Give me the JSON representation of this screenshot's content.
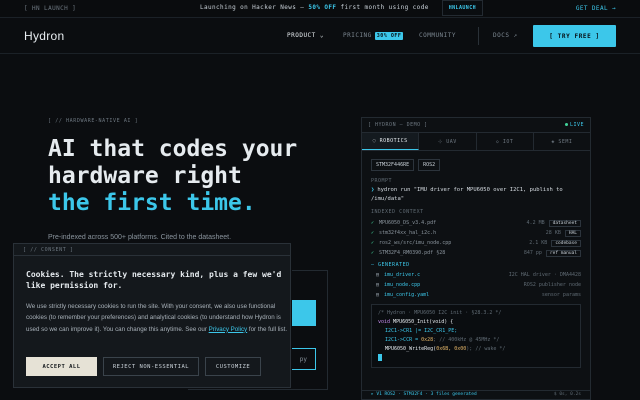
{
  "announce": {
    "tag": "[ HN LAUNCH ]",
    "msg_prefix": "Launching on Hacker News — ",
    "msg_highlight": "50% OFF",
    "msg_mid": " first month using code ",
    "msg_code": "HNLAUNCH",
    "deal": "GET DEAL →"
  },
  "nav": {
    "logo": "Hydron",
    "items": [
      {
        "label": "PRODUCT ⌄"
      },
      {
        "label": "PRICING",
        "badge": "30% OFF"
      },
      {
        "label": "COMMUNITY"
      },
      {
        "label": "DOCS ↗"
      }
    ],
    "cta": "[ TRY FREE ]"
  },
  "hero": {
    "eyebrow": "[ // HARDWARE-NATIVE AI ]",
    "line1": "AI that codes your",
    "line2": "hardware right",
    "line3": "the first time.",
    "sub": "Pre-indexed across 500+ platforms. Cited to the datasheet.",
    "ghost_tail": "py"
  },
  "demo": {
    "header": "[ HYDRON — DEMO ]",
    "live": "LIVE",
    "tabs": [
      "◌ ROBOTICS",
      "⊹ UAV",
      "◇ IOT",
      "◈ SEMI"
    ],
    "chips": [
      "STM32F446RE",
      "ROS2"
    ],
    "prompt_label": "PROMPT",
    "prompt_text": "hydron run \"IMU driver for MPU6050 over I2C1, publish to /imu/data\"",
    "context_label": "INDEXED CONTEXT",
    "context": [
      {
        "name": "MPU6050_DS_v3.4.pdf",
        "size": "4.2 MB",
        "tag": "datasheet"
      },
      {
        "name": "stm32f4xx_hal_i2c.h",
        "size": "28 KB",
        "tag": "HAL"
      },
      {
        "name": "ros2_ws/src/imu_node.cpp",
        "size": "2.1 KB",
        "tag": "codebase"
      },
      {
        "name": "STM32F4_RM0390.pdf §28",
        "size": "847 pp",
        "tag": "ref manual"
      }
    ],
    "generated_label": "— GENERATED",
    "generated": [
      {
        "name": "imu_driver.c",
        "desc": "I2C HAL driver · DMA4428"
      },
      {
        "name": "imu_node.cpp",
        "desc": "ROS2 publisher node"
      },
      {
        "name": "imu_config.yaml",
        "desc": "sensor params"
      }
    ],
    "code": {
      "comment": "/* Hydron · MPU6050 I2C init · §28.3.2 */",
      "sig_kw": "void",
      "sig_fn": " MPU6050_Init(void) {",
      "l1a": "I2C1->CR1  |= I2C_CR1_PE;",
      "l2a": "I2C1->CCR   = ",
      "l2n": "0x28",
      "l2c": "; // 400kHz @ 45MHz */",
      "l3a": "MPU6050_WriteReg(",
      "l3n": "0x6B, 0x00",
      "l3c": "); // wake */"
    },
    "footer_left": "▸ V1 ROS2 · STM32F4 · 3 files generated",
    "footer_right": "$ 0s, 0.2s"
  },
  "cookie": {
    "tag": "[ // CONSENT ]",
    "title": "Cookies. The strictly necessary kind, plus a few we'd like permission for.",
    "body_pre": "We use strictly necessary cookies to run the site. With your consent, we also use functional cookies (to remember your preferences) and analytical cookies (to understand how Hydron is used so we can improve it). You can change this anytime. See our ",
    "link": "Privacy Policy",
    "body_post": " for the full list.",
    "accept": "ACCEPT ALL",
    "reject": "REJECT NON-ESSENTIAL",
    "customize": "CUSTOMIZE"
  },
  "colors": {
    "accent": "#3cc7ea",
    "background": "#0b0d10",
    "live_dot": "#42d39a"
  }
}
